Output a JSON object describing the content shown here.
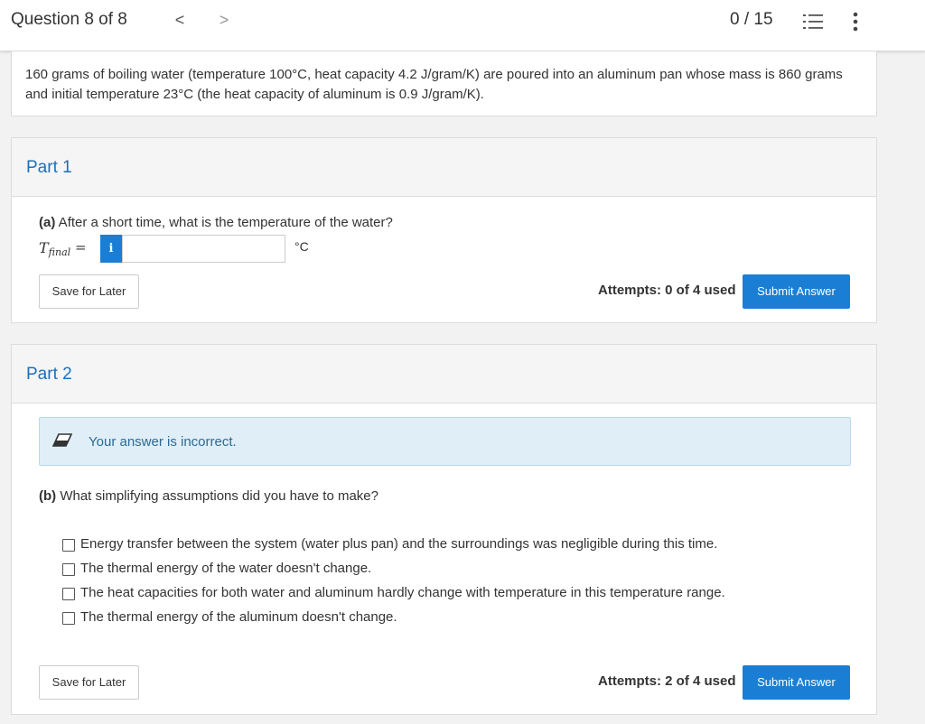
{
  "header": {
    "question_label": "Question 8 of 8",
    "prev": "<",
    "next": ">",
    "score": "0 / 15",
    "list_icon": "list-icon",
    "more_icon": "more-vertical-icon"
  },
  "problem": {
    "text": "160 grams of boiling water (temperature 100°C, heat capacity 4.2 J/gram/K) are poured into an aluminum pan whose mass is 860 grams and initial temperature 23°C (the heat capacity of aluminum is 0.9 J/gram/K)."
  },
  "part1": {
    "title": "Part 1",
    "question_prefix": "(a)",
    "question_text": " After a short time, what is the temperature of the water?",
    "var_main": "T",
    "var_sub": "final",
    "equals": "=",
    "info": "i",
    "input_value": "",
    "unit": "°C",
    "save_label": "Save for Later",
    "attempts": "Attempts: 0 of 4 used",
    "submit_label": "Submit Answer"
  },
  "part2": {
    "title": "Part 2",
    "feedback": "Your answer is incorrect.",
    "question_prefix": "(b)",
    "question_text": " What simplifying assumptions did you have to make?",
    "options": [
      {
        "label": "Energy transfer between the system (water plus pan) and the surroundings was negligible during this time.",
        "checked": false
      },
      {
        "label": "The thermal energy of the water doesn't change.",
        "checked": false
      },
      {
        "label": "The heat capacities for both water and aluminum hardly change with temperature in this temperature range.",
        "checked": false
      },
      {
        "label": "The thermal energy of the aluminum doesn't change.",
        "checked": false
      }
    ],
    "save_label": "Save for Later",
    "attempts": "Attempts: 2 of 4 used",
    "submit_label": "Submit Answer"
  },
  "colors": {
    "accent": "#1a7fd4",
    "part_title": "#1a6fbf",
    "feedback_bg": "#dfeef7"
  }
}
